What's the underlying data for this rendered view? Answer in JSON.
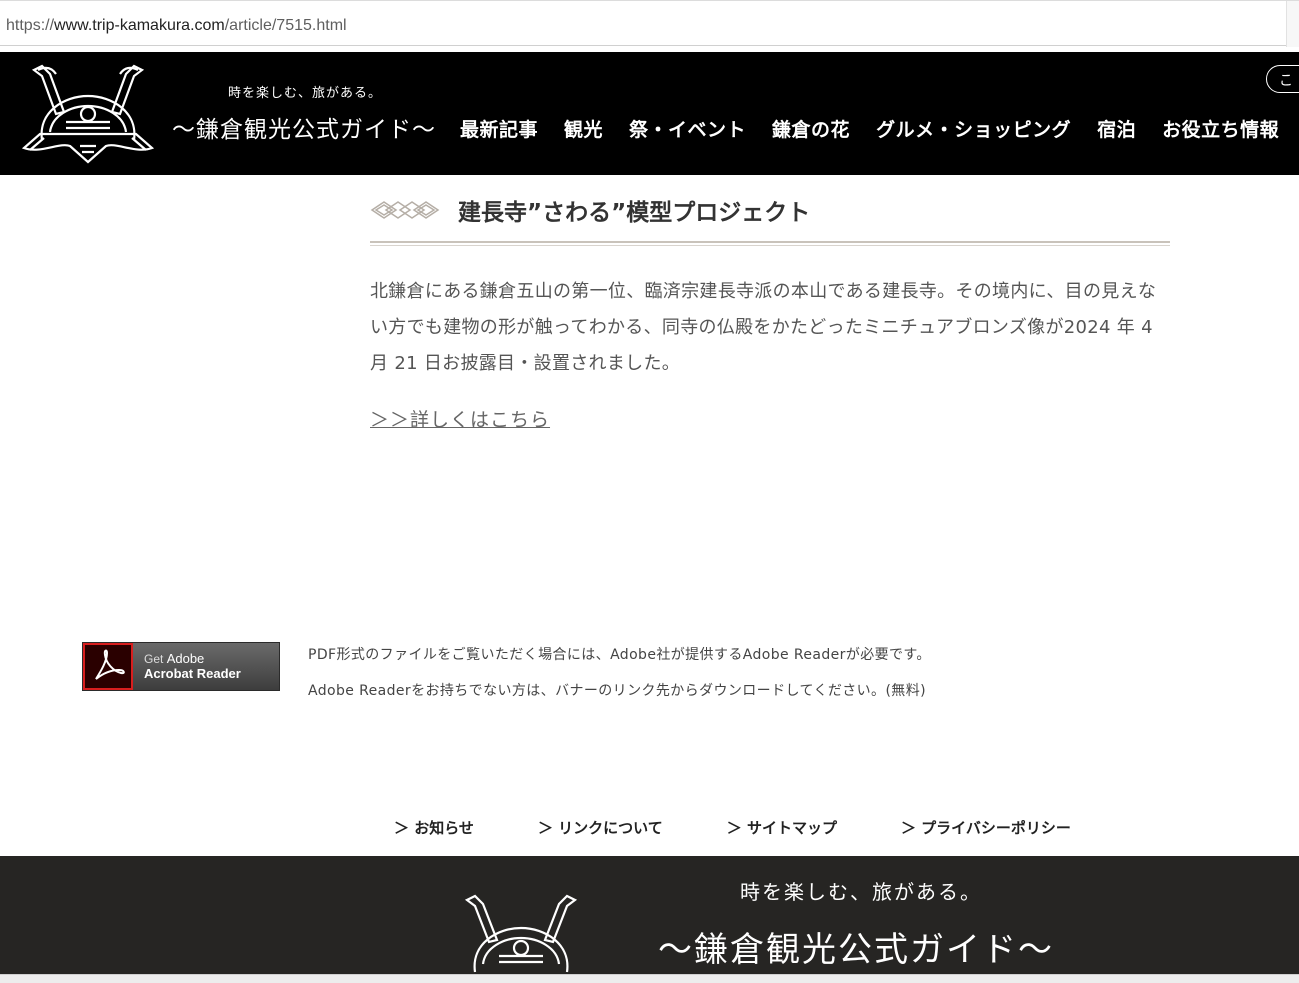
{
  "browser": {
    "url_scheme": "https://",
    "url_host": "www.trip-kamakura.com",
    "url_path": "/article/7515.html"
  },
  "header": {
    "tagline": "時を楽しむ、旅がある。",
    "site_title": "〜鎌倉観光公式ガイド〜",
    "nav": [
      "最新記事",
      "観光",
      "祭・イベント",
      "鎌倉の花",
      "グルメ・ショッピング",
      "宿泊",
      "お役立ち情報"
    ],
    "pill_label": "こ"
  },
  "article": {
    "title": "建長寺”さわる”模型プロジェクト",
    "body": "北鎌倉にある鎌倉五山の第一位、臨済宗建長寺派の本山である建長寺。その境内に、目の見えない方でも建物の形が触ってわかる、同寺の仏殿をかたどったミニチュアブロンズ像が2024 年 4 月 21 日お披露目・設置されました。",
    "more_link": "＞＞詳しくはこちら"
  },
  "adobe": {
    "banner_get": "Get",
    "banner_adobe": "Adobe",
    "banner_reader": "Acrobat Reader",
    "line1": "PDF形式のファイルをご覧いただく場合には、Adobe社が提供するAdobe Readerが必要です。",
    "line2": "Adobe Readerをお持ちでない方は、バナーのリンク先からダウンロードしてください。(無料)"
  },
  "footer_links": [
    "＞ お知らせ",
    "＞ リンクについて",
    "＞ サイトマップ",
    "＞ プライバシーポリシー"
  ],
  "footer": {
    "tagline": "時を楽しむ、旅がある。",
    "title": "〜鎌倉観光公式ガイド〜"
  }
}
